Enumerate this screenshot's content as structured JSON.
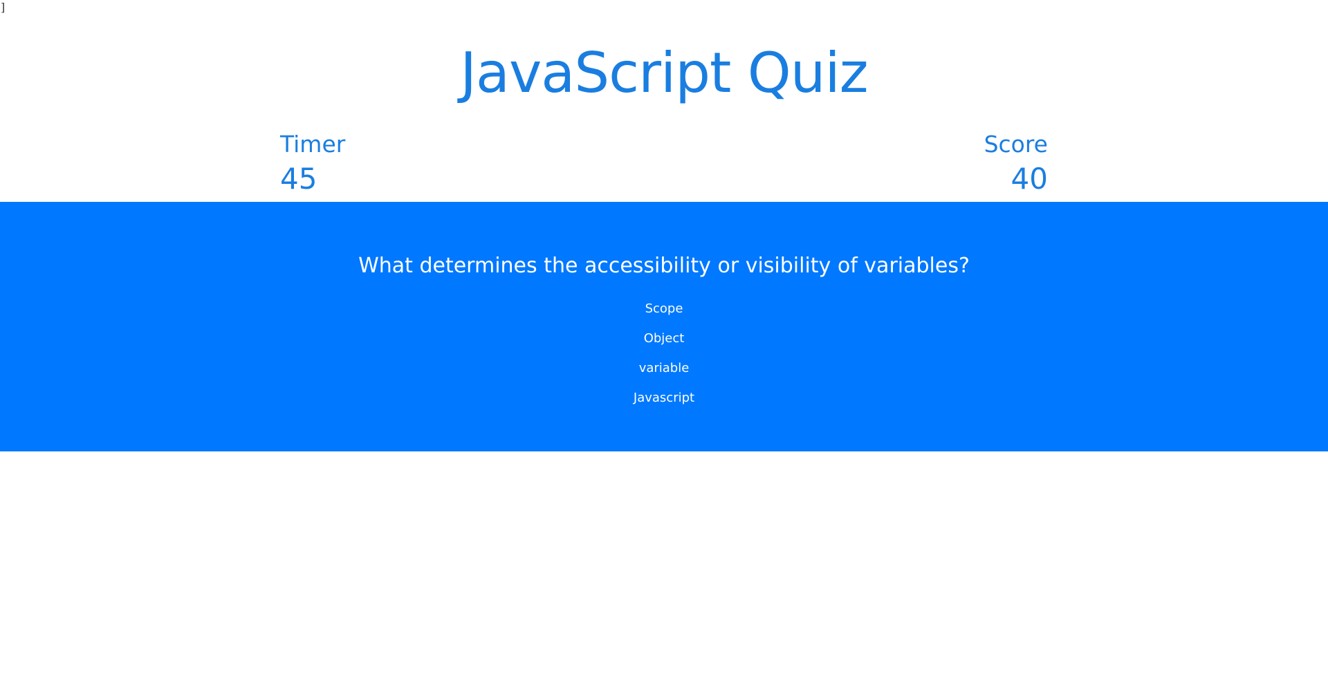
{
  "stray_text": "]",
  "header": {
    "title": "JavaScript Quiz"
  },
  "stats": {
    "timer_label": "Timer",
    "timer_value": "45",
    "score_label": "Score",
    "score_value": "40"
  },
  "quiz": {
    "question": "What determines the accessibility or visibility of variables?",
    "choices": [
      "Scope",
      "Object",
      "variable",
      "Javascript"
    ]
  },
  "colors": {
    "accent": "#1a7ee0",
    "band": "#0078ff",
    "band_text": "#ffffff"
  }
}
